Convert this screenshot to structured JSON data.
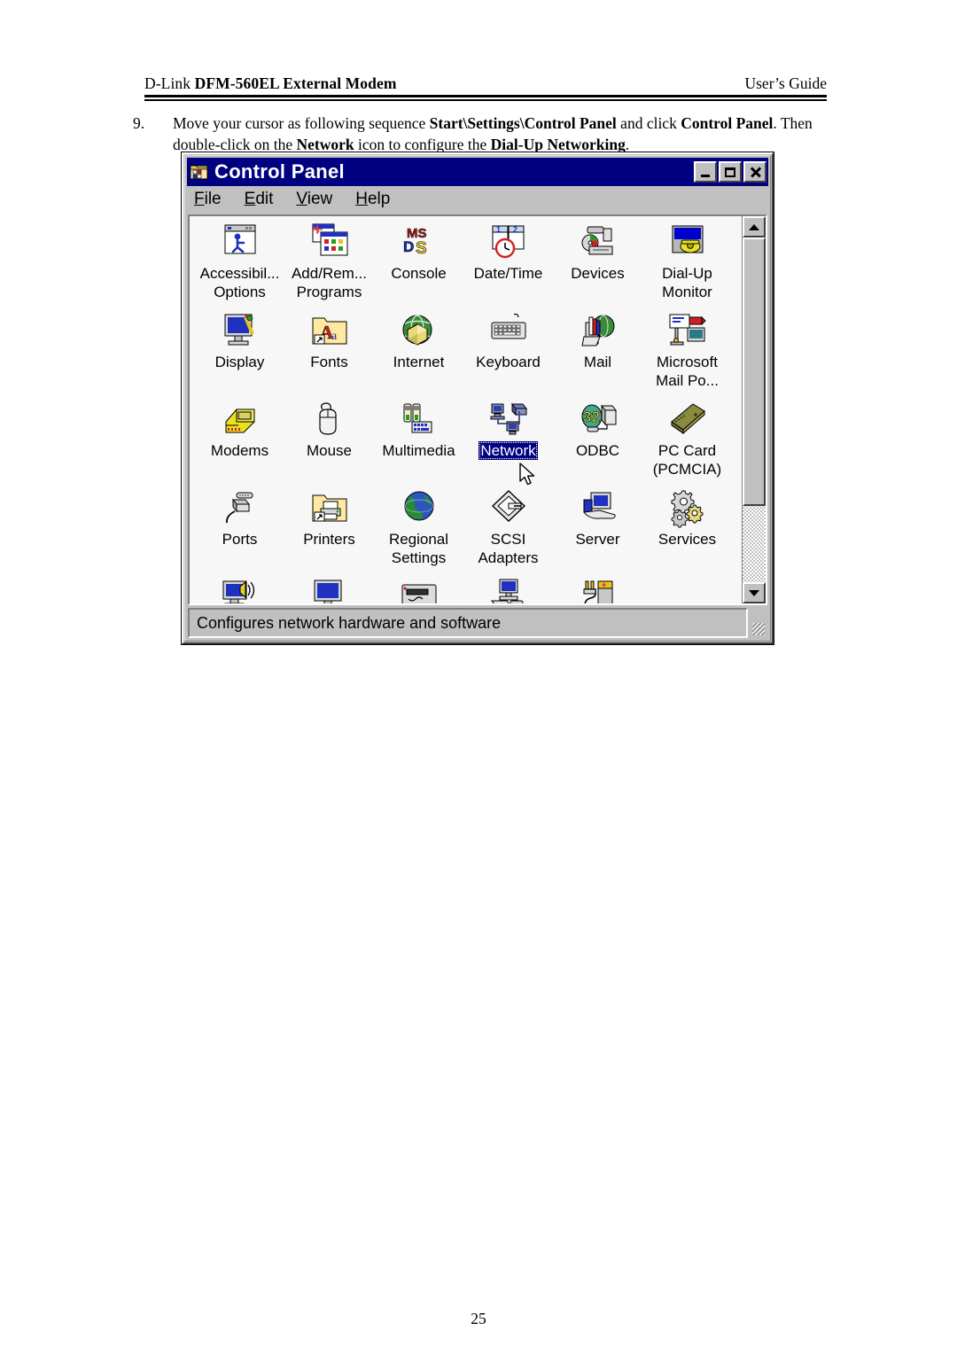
{
  "document": {
    "header_left_prefix": "D-Link ",
    "header_left_model": "DFM-560EL External Modem",
    "header_right": "User’s Guide",
    "page_number": "25"
  },
  "instruction": {
    "number": "9.",
    "line1_a": "Move your cursor as following sequence ",
    "line1_b": "Start\\Settings\\Control Panel",
    "line1_c": " and click ",
    "line1_d": "Control Panel",
    "line1_e": ".",
    "line2_a": "Then double-click on the ",
    "line2_b": "Network",
    "line2_c": " icon to configure the ",
    "line2_d": "Dial-Up Networking",
    "line2_e": "."
  },
  "window": {
    "title": "Control Panel",
    "title_icon": "control-panel-icon",
    "titlebar_color": "#000080",
    "face_color": "#c0c0c0",
    "client_color": "#f7f7f7",
    "controls": {
      "minimize": "minimize-button",
      "maximize": "maximize-button",
      "close": "close-button"
    },
    "menu": [
      {
        "label": "File",
        "accel": "F"
      },
      {
        "label": "Edit",
        "accel": "E"
      },
      {
        "label": "View",
        "accel": "V"
      },
      {
        "label": "Help",
        "accel": "H"
      }
    ],
    "statusbar": "Configures network hardware and software",
    "scrollbar": {
      "up": "scroll-up-arrow",
      "down": "scroll-down-arrow",
      "thumb_fraction": 0.78
    },
    "selection": {
      "selected_item": "Network",
      "highlight_color": "#000080",
      "highlight_text_color": "#ffffff"
    },
    "icons": [
      {
        "label": "Accessibil...\nOptions",
        "name": "accessibility-options",
        "icon": "accessibility-icon"
      },
      {
        "label": "Add/Rem...\nPrograms",
        "name": "add-remove-programs",
        "icon": "add-remove-icon"
      },
      {
        "label": "Console",
        "name": "console",
        "icon": "msdos-icon"
      },
      {
        "label": "Date/Time",
        "name": "date-time",
        "icon": "calendar-clock-icon"
      },
      {
        "label": "Devices",
        "name": "devices",
        "icon": "devices-icon"
      },
      {
        "label": "Dial-Up\nMonitor",
        "name": "dial-up-monitor",
        "icon": "dialup-monitor-icon"
      },
      {
        "label": "Display",
        "name": "display",
        "icon": "display-icon"
      },
      {
        "label": "Fonts",
        "name": "fonts",
        "icon": "fonts-folder-icon"
      },
      {
        "label": "Internet",
        "name": "internet",
        "icon": "internet-globe-icon"
      },
      {
        "label": "Keyboard",
        "name": "keyboard",
        "icon": "keyboard-icon"
      },
      {
        "label": "Mail",
        "name": "mail",
        "icon": "mail-icon"
      },
      {
        "label": "Microsoft\nMail Po...",
        "name": "microsoft-mail-postoffice",
        "icon": "mail-postoffice-icon"
      },
      {
        "label": "Modems",
        "name": "modems",
        "icon": "modem-phone-icon"
      },
      {
        "label": "Mouse",
        "name": "mouse",
        "icon": "mouse-icon"
      },
      {
        "label": "Multimedia",
        "name": "multimedia",
        "icon": "multimedia-icon"
      },
      {
        "label": "Network",
        "name": "network",
        "icon": "network-icon",
        "selected": true
      },
      {
        "label": "ODBC",
        "name": "odbc",
        "icon": "odbc-32-icon"
      },
      {
        "label": "PC Card\n(PCMCIA)",
        "name": "pc-card-pcmcia",
        "icon": "pccard-icon"
      },
      {
        "label": "Ports",
        "name": "ports",
        "icon": "ports-plug-icon"
      },
      {
        "label": "Printers",
        "name": "printers",
        "icon": "printers-folder-icon"
      },
      {
        "label": "Regional\nSettings",
        "name": "regional-settings",
        "icon": "globe-icon"
      },
      {
        "label": "SCSI\nAdapters",
        "name": "scsi-adapters",
        "icon": "scsi-icon"
      },
      {
        "label": "Server",
        "name": "server",
        "icon": "server-hand-icon"
      },
      {
        "label": "Services",
        "name": "services",
        "icon": "gears-icon"
      },
      {
        "label": "",
        "name": "sounds",
        "icon": "sounds-speaker-icon"
      },
      {
        "label": "",
        "name": "system",
        "icon": "system-monitor-icon"
      },
      {
        "label": "",
        "name": "tape-devices",
        "icon": "tape-device-icon"
      },
      {
        "label": "",
        "name": "telephony",
        "icon": "telephony-icon"
      },
      {
        "label": "",
        "name": "ups",
        "icon": "ups-battery-icon"
      }
    ]
  }
}
